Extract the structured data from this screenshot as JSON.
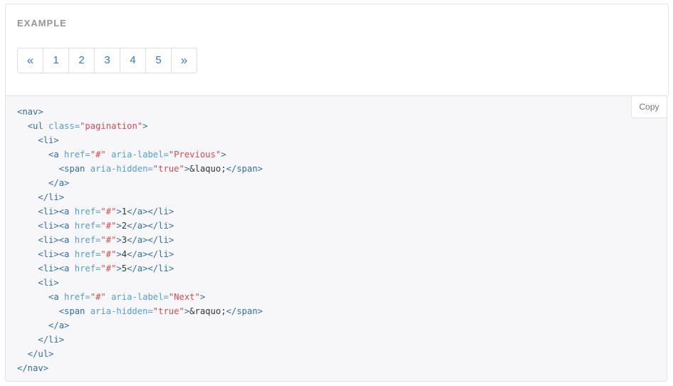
{
  "example": {
    "label": "EXAMPLE",
    "pagination": [
      {
        "label": "«",
        "kind": "prev"
      },
      {
        "label": "1",
        "kind": "num"
      },
      {
        "label": "2",
        "kind": "num"
      },
      {
        "label": "3",
        "kind": "num"
      },
      {
        "label": "4",
        "kind": "num"
      },
      {
        "label": "5",
        "kind": "num"
      },
      {
        "label": "»",
        "kind": "next"
      }
    ]
  },
  "code": {
    "copy_label": "Copy",
    "colors": {
      "tag": "#2f6f9f",
      "attr": "#4f9fcf",
      "value": "#d44950",
      "text": "#333333"
    },
    "lines": [
      [
        [
          "tag",
          "<nav>"
        ]
      ],
      [
        [
          "text",
          "  "
        ],
        [
          "tag",
          "<ul "
        ],
        [
          "attr",
          "class="
        ],
        [
          "val",
          "\"pagination\""
        ],
        [
          "tag",
          ">"
        ]
      ],
      [
        [
          "text",
          "    "
        ],
        [
          "tag",
          "<li>"
        ]
      ],
      [
        [
          "text",
          "      "
        ],
        [
          "tag",
          "<a "
        ],
        [
          "attr",
          "href="
        ],
        [
          "val",
          "\"#\""
        ],
        [
          "text",
          " "
        ],
        [
          "attr",
          "aria-label="
        ],
        [
          "val",
          "\"Previous\""
        ],
        [
          "tag",
          ">"
        ]
      ],
      [
        [
          "text",
          "        "
        ],
        [
          "tag",
          "<span "
        ],
        [
          "attr",
          "aria-hidden="
        ],
        [
          "val",
          "\"true\""
        ],
        [
          "tag",
          ">"
        ],
        [
          "text",
          "&laquo;"
        ],
        [
          "tag",
          "</span>"
        ]
      ],
      [
        [
          "text",
          "      "
        ],
        [
          "tag",
          "</a>"
        ]
      ],
      [
        [
          "text",
          "    "
        ],
        [
          "tag",
          "</li>"
        ]
      ],
      [
        [
          "text",
          "    "
        ],
        [
          "tag",
          "<li><a "
        ],
        [
          "attr",
          "href="
        ],
        [
          "val",
          "\"#\""
        ],
        [
          "tag",
          ">"
        ],
        [
          "text",
          "1"
        ],
        [
          "tag",
          "</a></li>"
        ]
      ],
      [
        [
          "text",
          "    "
        ],
        [
          "tag",
          "<li><a "
        ],
        [
          "attr",
          "href="
        ],
        [
          "val",
          "\"#\""
        ],
        [
          "tag",
          ">"
        ],
        [
          "text",
          "2"
        ],
        [
          "tag",
          "</a></li>"
        ]
      ],
      [
        [
          "text",
          "    "
        ],
        [
          "tag",
          "<li><a "
        ],
        [
          "attr",
          "href="
        ],
        [
          "val",
          "\"#\""
        ],
        [
          "tag",
          ">"
        ],
        [
          "text",
          "3"
        ],
        [
          "tag",
          "</a></li>"
        ]
      ],
      [
        [
          "text",
          "    "
        ],
        [
          "tag",
          "<li><a "
        ],
        [
          "attr",
          "href="
        ],
        [
          "val",
          "\"#\""
        ],
        [
          "tag",
          ">"
        ],
        [
          "text",
          "4"
        ],
        [
          "tag",
          "</a></li>"
        ]
      ],
      [
        [
          "text",
          "    "
        ],
        [
          "tag",
          "<li><a "
        ],
        [
          "attr",
          "href="
        ],
        [
          "val",
          "\"#\""
        ],
        [
          "tag",
          ">"
        ],
        [
          "text",
          "5"
        ],
        [
          "tag",
          "</a></li>"
        ]
      ],
      [
        [
          "text",
          "    "
        ],
        [
          "tag",
          "<li>"
        ]
      ],
      [
        [
          "text",
          "      "
        ],
        [
          "tag",
          "<a "
        ],
        [
          "attr",
          "href="
        ],
        [
          "val",
          "\"#\""
        ],
        [
          "text",
          " "
        ],
        [
          "attr",
          "aria-label="
        ],
        [
          "val",
          "\"Next\""
        ],
        [
          "tag",
          ">"
        ]
      ],
      [
        [
          "text",
          "        "
        ],
        [
          "tag",
          "<span "
        ],
        [
          "attr",
          "aria-hidden="
        ],
        [
          "val",
          "\"true\""
        ],
        [
          "tag",
          ">"
        ],
        [
          "text",
          "&raquo;"
        ],
        [
          "tag",
          "</span>"
        ]
      ],
      [
        [
          "text",
          "      "
        ],
        [
          "tag",
          "</a>"
        ]
      ],
      [
        [
          "text",
          "    "
        ],
        [
          "tag",
          "</li>"
        ]
      ],
      [
        [
          "text",
          "  "
        ],
        [
          "tag",
          "</ul>"
        ]
      ],
      [
        [
          "tag",
          "</nav>"
        ]
      ]
    ]
  }
}
